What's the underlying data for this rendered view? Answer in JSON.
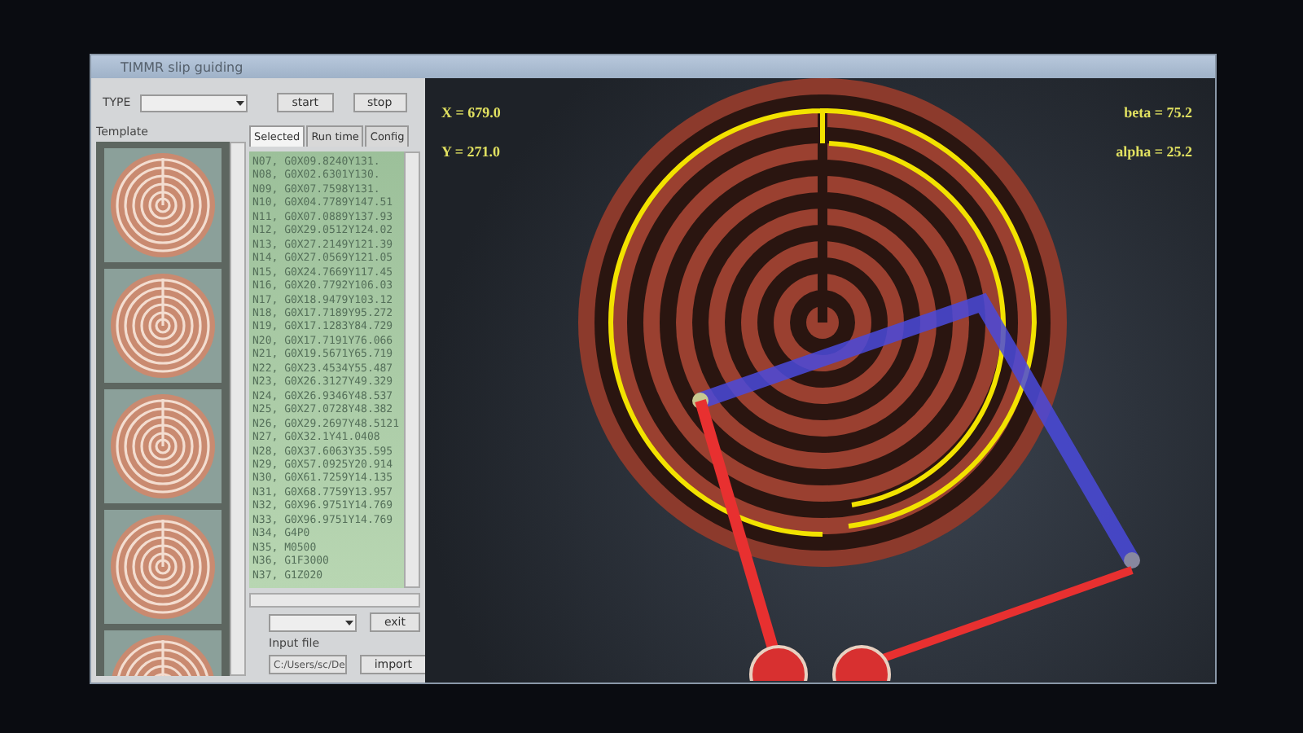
{
  "window": {
    "title": "TIMMR slip guiding"
  },
  "controls": {
    "type_label": "TYPE",
    "start": "start",
    "stop": "stop"
  },
  "template": {
    "label": "Template"
  },
  "tabs": [
    {
      "label": "Selected",
      "selected": true
    },
    {
      "label": "Run time",
      "selected": false
    },
    {
      "label": "Config",
      "selected": false
    }
  ],
  "listing": [
    "N07, G0X09.8240Y131.",
    "N08, G0X02.6301Y130.",
    "N09, G0X07.7598Y131.",
    "N10, G0X04.7789Y147.51",
    "N11, G0X07.0889Y137.93",
    "N12, G0X29.0512Y124.02",
    "N13, G0X27.2149Y121.39",
    "N14, G0X27.0569Y121.05",
    "N15, G0X24.7669Y117.45",
    "N16, G0X20.7792Y106.03",
    "N17, G0X18.9479Y103.12",
    "N18, G0X17.7189Y95.272",
    "N19, G0X17.1283Y84.729",
    "N20, G0X17.7191Y76.066",
    "N21, G0X19.5671Y65.719",
    "N22, G0X23.4534Y55.487",
    "N23, G0X26.3127Y49.329",
    "N24, G0X26.9346Y48.537",
    "N25, G0X27.0728Y48.382",
    "N26, G0X29.2697Y48.5121",
    "N27, G0X32.1Y41.0408",
    "N28, G0X37.6063Y35.595",
    "N29, G0X57.0925Y20.914",
    "N30, G0X61.7259Y14.135",
    "N31, G0X68.7759Y13.957",
    "N32, G0X96.9751Y14.769",
    "N33, G0X96.9751Y14.769",
    "N34, G4P0",
    "N35, M0500",
    "N36, G1F3000",
    "N37, G1Z020"
  ],
  "exit": "exit",
  "input_file": {
    "label": "Input file",
    "value": "C:/Users/sc/De",
    "button": "import"
  },
  "readouts": {
    "x": "X = 679.0",
    "y": "Y = 271.0",
    "beta": "beta = 75.2",
    "alpha": "alpha = 25.2"
  }
}
